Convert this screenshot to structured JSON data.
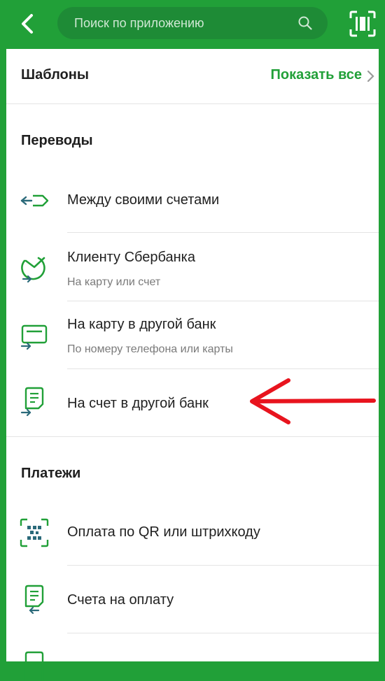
{
  "header": {
    "search_placeholder": "Поиск по приложению",
    "back_icon": "chevron-left-icon",
    "search_icon": "search-icon",
    "scan_icon": "scan-barcode-icon"
  },
  "templates": {
    "title": "Шаблоны",
    "show_all": "Показать все"
  },
  "sections": {
    "transfers": {
      "title": "Переводы",
      "items": [
        {
          "title": "Между своими счетами",
          "subtitle": "",
          "icon": "transfer-arrows-icon"
        },
        {
          "title": "Клиенту Сбербанка",
          "subtitle": "На карту или счет",
          "icon": "sber-logo-transfer-icon"
        },
        {
          "title": "На карту в другой банк",
          "subtitle": "По номеру телефона или карты",
          "icon": "card-transfer-icon"
        },
        {
          "title": "На счет в другой банк",
          "subtitle": "",
          "icon": "document-transfer-icon"
        }
      ]
    },
    "payments": {
      "title": "Платежи",
      "items": [
        {
          "title": "Оплата по QR или штрихкоду",
          "subtitle": "",
          "icon": "qr-code-icon"
        },
        {
          "title": "Счета на оплату",
          "subtitle": "",
          "icon": "invoice-icon"
        }
      ]
    }
  },
  "colors": {
    "brand_green": "#21A038",
    "annotation_red": "#E8141E"
  }
}
